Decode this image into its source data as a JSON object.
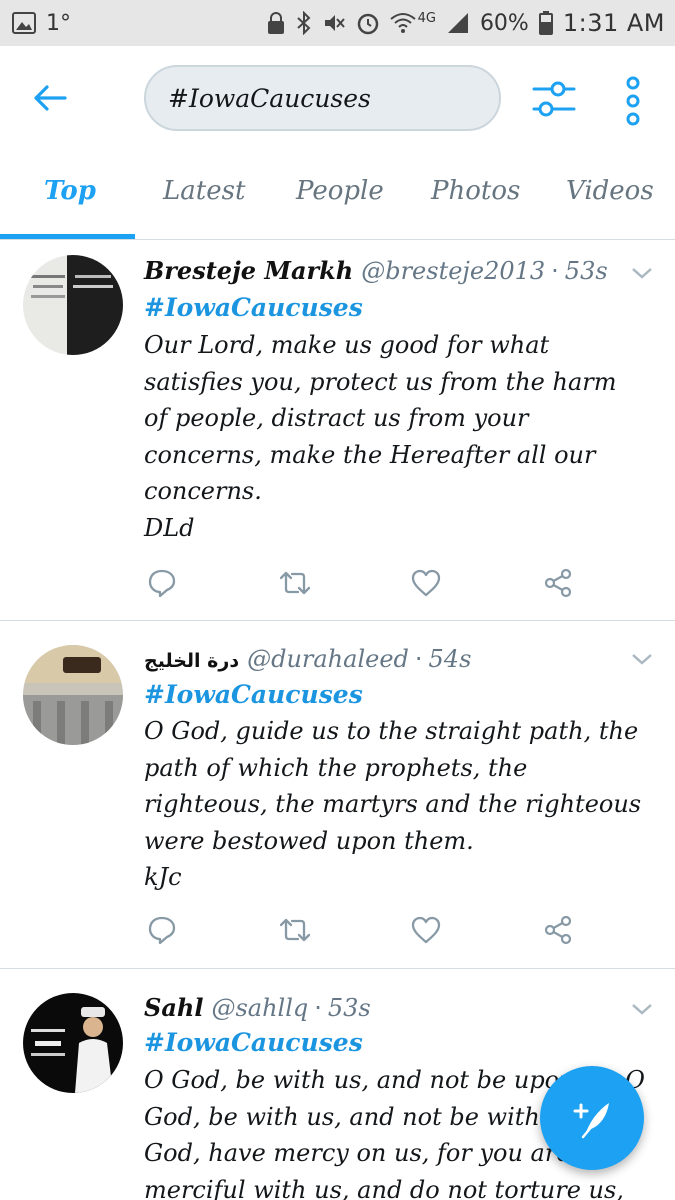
{
  "status_bar": {
    "left_indicator": "1°",
    "network": "4G",
    "battery": "60%",
    "time": "1:31 AM",
    "icons": [
      "image-icon",
      "lock-icon",
      "bluetooth-icon",
      "mute-icon",
      "alarm-icon",
      "wifi-icon",
      "signal-icon",
      "battery-icon"
    ]
  },
  "search": {
    "query": "#IowaCaucuses"
  },
  "tabs": [
    {
      "label": "Top",
      "active": true
    },
    {
      "label": "Latest",
      "active": false
    },
    {
      "label": "People",
      "active": false
    },
    {
      "label": "Photos",
      "active": false
    },
    {
      "label": "Videos",
      "active": false
    }
  ],
  "tweets": [
    {
      "name": "Bresteje Markh",
      "handle": "@bresteje2013",
      "time": "53s",
      "hashtag": "#IowaCaucuses",
      "body": "Our Lord, make us good for what\nsatisfies you, protect us from the harm\nof people, distract us from your\nconcerns, make the Hereafter all our\nconcerns.\nDLd"
    },
    {
      "name": "درة الخليج",
      "handle": "@durahaleed",
      "time": "54s",
      "hashtag": "#IowaCaucuses",
      "body": "O God, guide us to the straight path, the\npath of which the prophets, the\nrighteous, the martyrs and the righteous\nwere bestowed upon them.\nkJc"
    },
    {
      "name": "Sahl",
      "handle": "@sahllq",
      "time": "53s",
      "hashtag": "#IowaCaucuses",
      "body": "O God, be with us, and not be upon us, O\nGod, be with us, and not be with us, O\nGod, have mercy on us, for you are\nmerciful with us, and do not torture us,"
    }
  ],
  "tweet_actions": [
    "reply-icon",
    "retweet-icon",
    "like-icon",
    "share-icon"
  ],
  "colors": {
    "accent": "#1da1f2",
    "status_bar_bg": "#e6e6e6",
    "secondary_text": "#657786",
    "hashtag": "#1b95e0"
  }
}
